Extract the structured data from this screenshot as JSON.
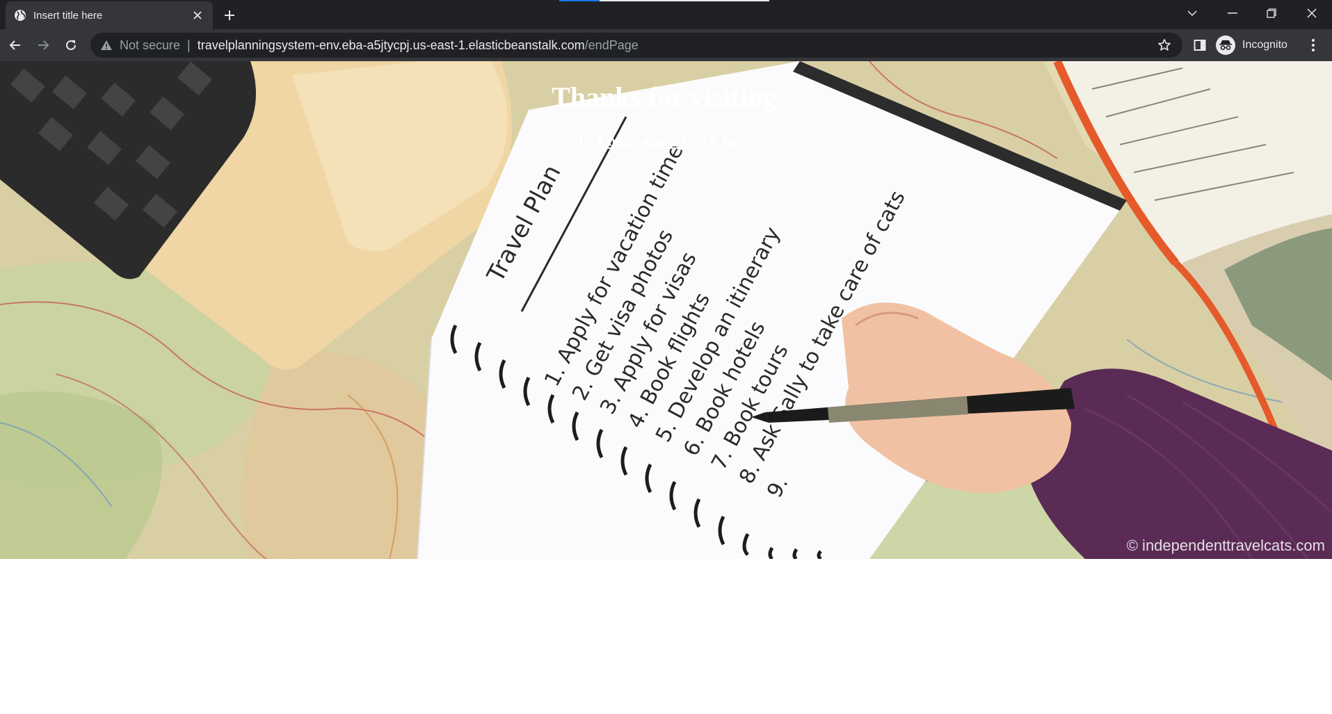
{
  "browser": {
    "tab_title": "Insert title here",
    "security_label": "Not secure",
    "url_host": "travelplanningsystem-env.eba-a5jtycpj.us-east-1.elasticbeanstalk.com",
    "url_path": "/endPage",
    "profile_label": "Incognito",
    "icons": [
      "globe-icon",
      "close-icon",
      "plus-icon",
      "chevron-down-icon",
      "minimize-icon",
      "restore-icon",
      "back-arrow-icon",
      "forward-arrow-icon",
      "reload-icon",
      "warning-icon",
      "star-icon",
      "side-panel-icon",
      "incognito-icon",
      "more-vert-icon"
    ]
  },
  "page": {
    "heading": "Thanks for visiting",
    "login_link": "To Login again Click here",
    "image_credit": "© independenttravelcats.com",
    "notebook_text": {
      "title": "Travel Plan",
      "items": [
        "1. Apply for vacation time",
        "2. Get visa photos",
        "3. Apply for visas",
        "4. Book flights",
        "5. Develop an itinerary",
        "6. Book hotels",
        "7. Book tours",
        "8. Ask Sally to take care of cats",
        "9."
      ]
    }
  }
}
